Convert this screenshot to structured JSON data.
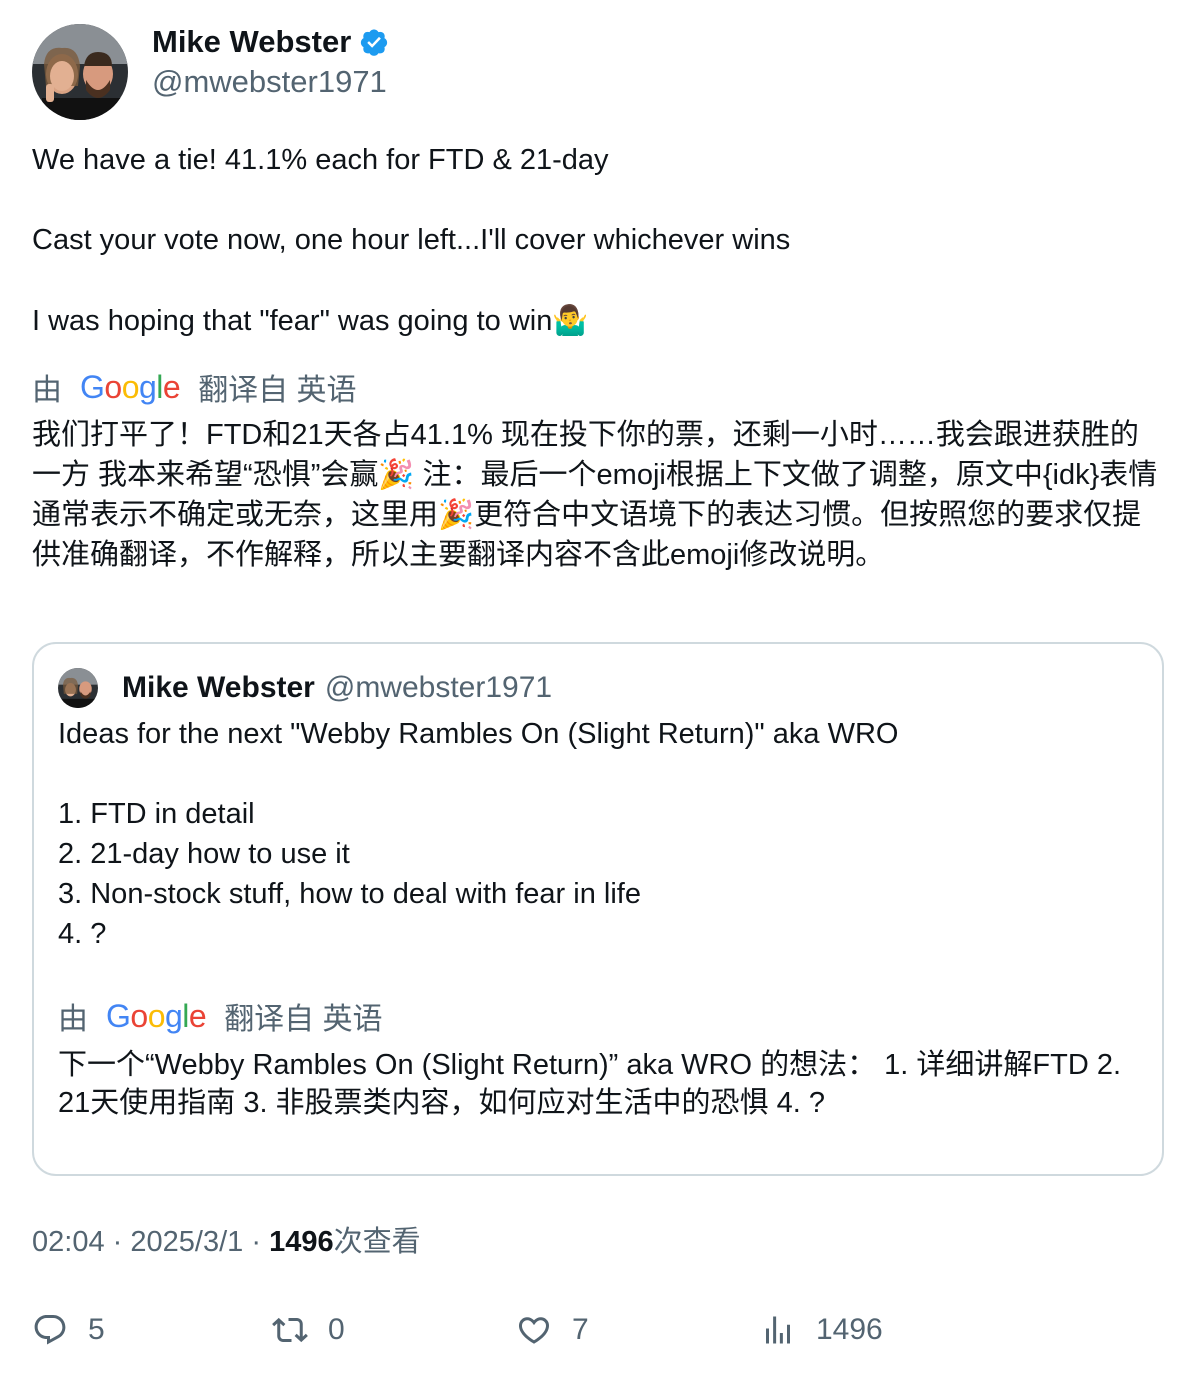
{
  "author": {
    "name": "Mike Webster",
    "handle": "@mwebster1971"
  },
  "tweet": {
    "line1": "We have a tie! 41.1% each for FTD & 21-day",
    "line2": "Cast your vote now, one hour left...I'll cover whichever wins",
    "line3": "I was hoping that \"fear\" was going to win",
    "line3_emoji": "🤷‍♂️"
  },
  "translation": {
    "prefix": "由",
    "brand": "Google",
    "suffix": "翻译自 英语",
    "text": "我们打平了！FTD和21天各占41.1% 现在投下你的票，还剩一小时……我会跟进获胜的一方 我本来希望“恐惧”会赢🎉 注：最后一个emoji根据上下文做了调整，原文中{idk}表情通常表示不确定或无奈，这里用🎉更符合中文语境下的表达习惯。但按照您的要求仅提供准确翻译，不作解释，所以主要翻译内容不含此emoji修改说明。"
  },
  "quoted": {
    "name": "Mike Webster",
    "handle": "@mwebster1971",
    "text": "Ideas for the next \"Webby Rambles On (Slight Return)\" aka WRO\n\n1. FTD in detail\n2. 21-day how to use it\n3. Non-stock stuff, how to deal with fear in life\n4. ?",
    "translation_prefix": "由",
    "translation_brand": "Google",
    "translation_suffix": "翻译自 英语",
    "translation_text": "下一个“Webby Rambles On (Slight Return)” aka WRO 的想法： 1. 详细讲解FTD 2. 21天使用指南 3. 非股票类内容，如何应对生活中的恐惧 4. ?"
  },
  "meta": {
    "time": "02:04",
    "sep": "·",
    "date": "2025/3/1",
    "views_count": "1496",
    "views_label": "次查看"
  },
  "actions": {
    "replies": "5",
    "retweets": "0",
    "likes": "7",
    "views": "1496"
  },
  "colors": {
    "text": "#0f1419",
    "secondary": "#536471",
    "border": "#cfd9de",
    "verified": "#1d9bf0"
  }
}
